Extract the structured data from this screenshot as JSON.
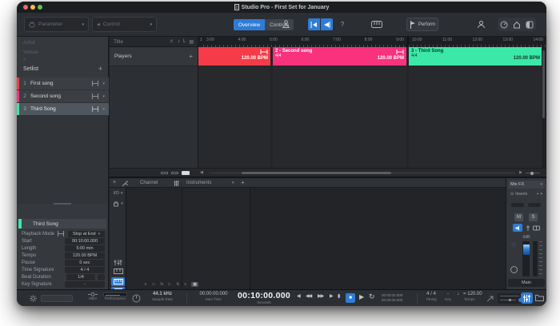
{
  "window": {
    "title": "Studio Pro - First Set for January"
  },
  "accent": "#2e7cd6",
  "toolbar": {
    "parameter_label": "Parameter",
    "control_label": "Control",
    "overview_label": "Overview",
    "controls_label": "Controls",
    "help_label": "?",
    "perform_label": "Perform"
  },
  "sidebar": {
    "artist_placeholder": "Artist",
    "venue_placeholder": "Venue",
    "setlist_label": "Setlist",
    "songs": [
      {
        "num": "1",
        "name": "First song",
        "color": "#f43b47"
      },
      {
        "num": "2",
        "name": "Second song",
        "color": "#f8327d"
      },
      {
        "num": "3",
        "name": "Third Song",
        "color": "#3be8a8"
      }
    ]
  },
  "inspector": {
    "title": "Third Song",
    "color": "#3be8a8",
    "rows": [
      {
        "label": "Playback Mode",
        "value": "Stop at End"
      },
      {
        "label": "Start",
        "value": "00:10:00.000"
      },
      {
        "label": "Length",
        "value": "5:00 min"
      },
      {
        "label": "Tempo",
        "value": "120.00 BPM"
      },
      {
        "label": "Pause",
        "value": "0 sec"
      },
      {
        "label": "Time Signature",
        "value": "4 / 4"
      },
      {
        "label": "Beat Duration",
        "value": "1/4"
      },
      {
        "label": "Key Signature",
        "value": "-"
      }
    ]
  },
  "arrange": {
    "title_header": "Title",
    "players_label": "Players",
    "ruler_start": "1",
    "ruler_left": [
      "3:00",
      "4:00",
      "5:00",
      "6:00",
      "7:00",
      "8:00",
      "9:00"
    ],
    "ruler_right": [
      "10:00",
      "11:00",
      "12:00",
      "13:00",
      "14:00"
    ],
    "blocks": [
      {
        "num": "",
        "name": "",
        "meter": "",
        "bpm": "120.00 BPM",
        "color": "#f43b47",
        "text_color": "#ffffff"
      },
      {
        "num": "2",
        "name": "Second song",
        "meter": "4/4",
        "bpm": "120.00 BPM",
        "color": "#f8327d",
        "text_color": "#ffffff"
      },
      {
        "num": "3",
        "name": "Third Song",
        "meter": "4/4",
        "bpm": "120.00 BPM",
        "color": "#3be8a8",
        "text_color": "#103826"
      }
    ]
  },
  "lower": {
    "channel_header": "Channel",
    "instruments_header": "Instruments",
    "io_label": "I/O",
    "tool_icons": [
      "∧",
      "▭",
      "fx",
      "▷",
      "⇅",
      "≡",
      "▦"
    ],
    "mixer": {
      "mixfx_label": "Mix FX",
      "inserts_label": "Inserts",
      "mute_label": "M",
      "solo_label": "S",
      "gain_label": "0dB",
      "main_label": "Main"
    }
  },
  "transport": {
    "midi_label": "MIDI",
    "performance_label": "Performance",
    "sample_rate_value": "44.1 kHz",
    "sample_rate_label": "Sample Rate",
    "item_time_value": "00:00:00.000",
    "item_time_label": "Item Time",
    "main_time_value": "00:10:00.000",
    "main_time_label": "Seconds",
    "loop_start": "00:00:00.000",
    "loop_end": "00:00:00.000",
    "timing_value": "4 / 4",
    "timing_label": "Timing",
    "key_value": "-",
    "key_label": "Key",
    "tempo_value": "♩ = 120.00",
    "tempo_label": "Tempo",
    "buttons": {
      "prev": "◀",
      "rew": "◀◀",
      "fwd": "▶▶",
      "step": "▶",
      "bar": "▮",
      "stop": "■",
      "play": "▶",
      "loop": "↻"
    }
  },
  "icons": {
    "caret": "▾",
    "plus": "+",
    "close": "×",
    "chevrons": "»",
    "left_arrow": "◀",
    "right_arrow": "▶",
    "note1": "♬",
    "note2": "♪",
    "letter_l": "L",
    "grid": "▤",
    "target": "⊙"
  }
}
